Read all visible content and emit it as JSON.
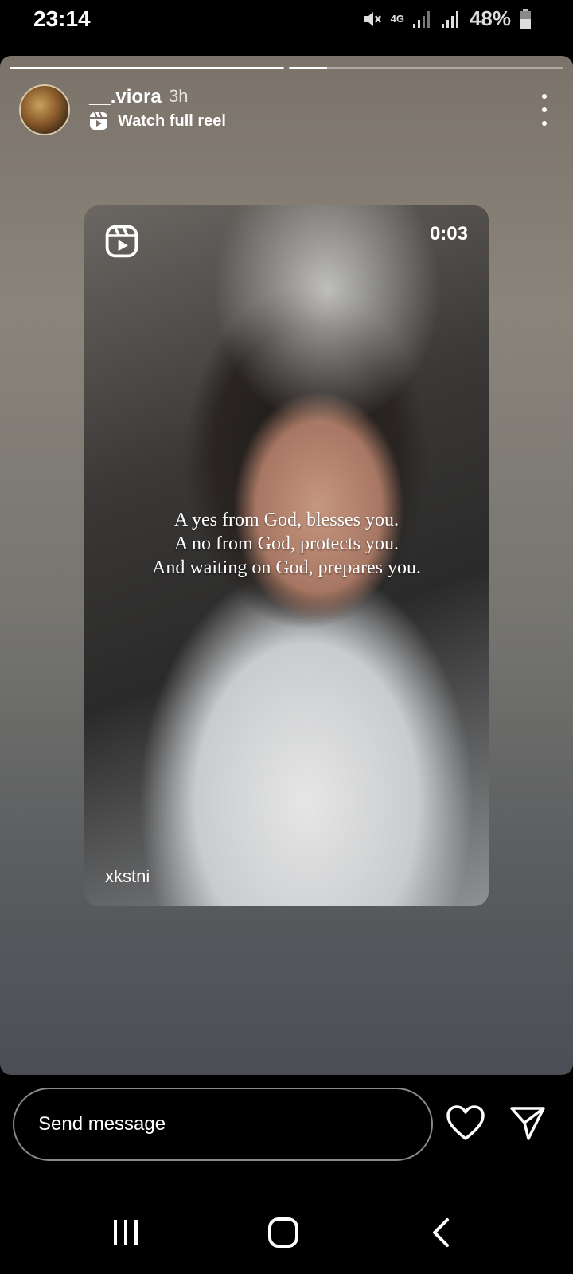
{
  "status_bar": {
    "time": "23:14",
    "network": "4G",
    "battery": "48%"
  },
  "story": {
    "progress": [
      1.0,
      0.14
    ],
    "username": "__.viora",
    "age": "3h",
    "reel_link_label": "Watch full reel",
    "reel": {
      "duration": "0:03",
      "quote_lines": [
        "A yes from God, blesses you.",
        "A no from God, protects you.",
        "And waiting on God, prepares you."
      ],
      "creator": "xkstni"
    }
  },
  "message_bar": {
    "placeholder": "Send message"
  },
  "icons": {
    "more": "more-vertical-icon",
    "reel": "reel-icon",
    "heart": "heart-icon",
    "send": "send-icon",
    "recents": "recents-icon",
    "home": "home-icon",
    "back": "back-icon"
  },
  "colors": {
    "story_bg_top": "#7b736a",
    "story_bg_bottom": "#4b4f55",
    "screen_bg": "#000000"
  }
}
